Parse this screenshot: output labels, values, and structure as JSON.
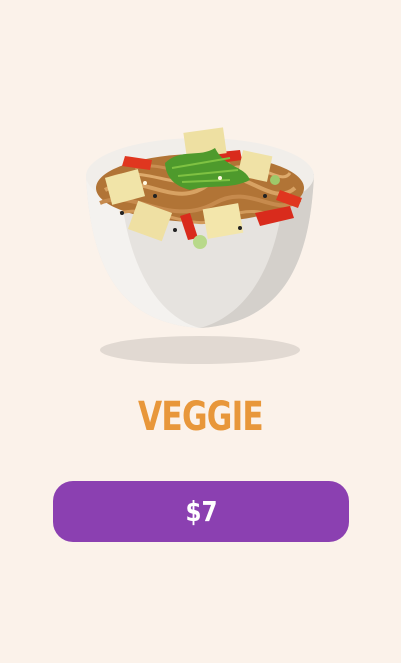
{
  "product": {
    "name": "VEGGIE",
    "image_icon": "noodle-bowl-icon",
    "price_label": "$7"
  },
  "colors": {
    "background": "#fbf2ea",
    "title": "#e8973a",
    "button": "#8b40b1",
    "button_text": "#ffffff"
  }
}
